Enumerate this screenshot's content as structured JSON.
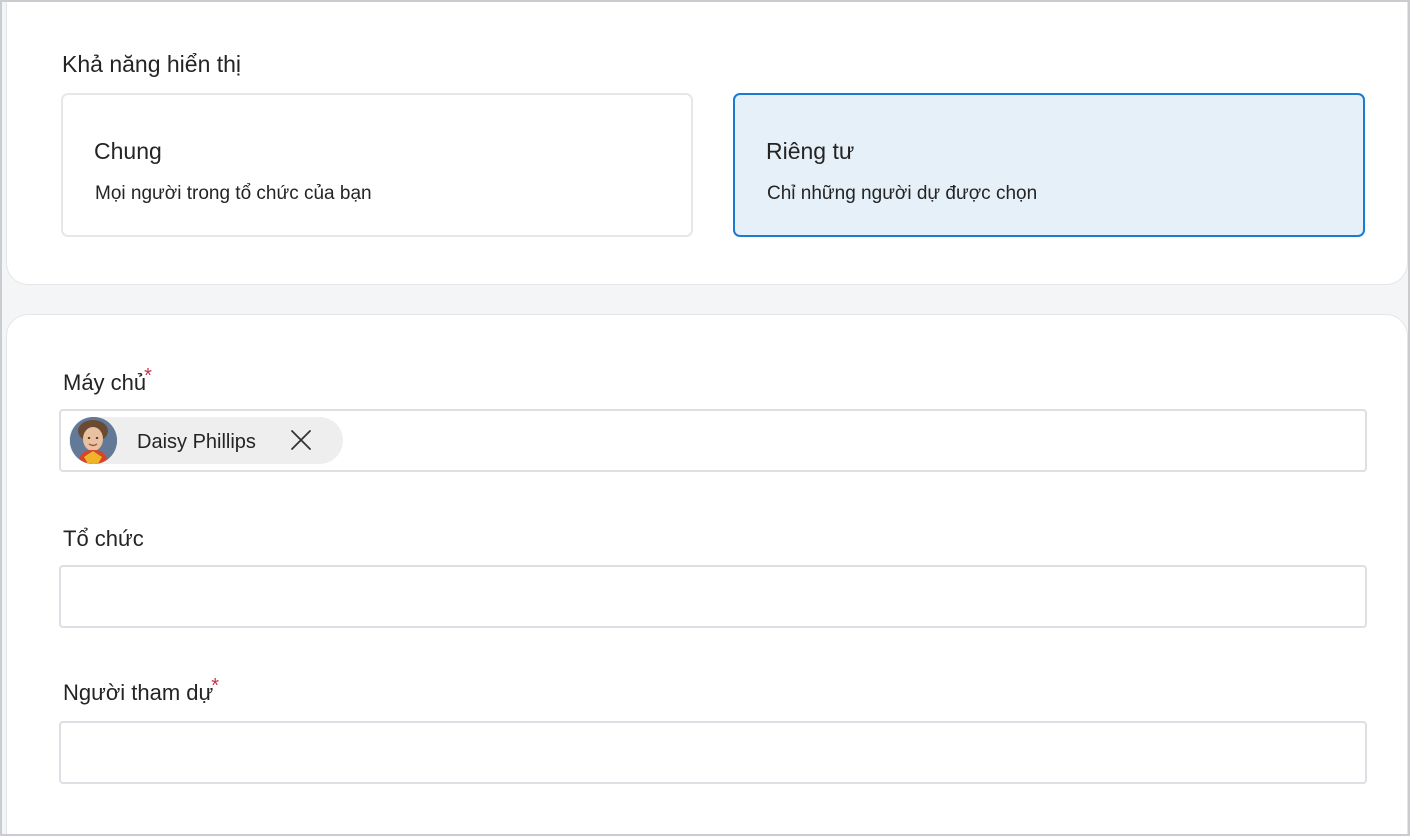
{
  "visibility": {
    "title": "Khả năng hiển thị",
    "options": [
      {
        "title": "Chung",
        "description": "Mọi người trong tổ chức của bạn",
        "selected": false
      },
      {
        "title": "Riêng tư",
        "description": "Chỉ những người dự được chọn",
        "selected": true
      }
    ]
  },
  "fields": {
    "host": {
      "label": "Máy chủ",
      "required_mark": "*",
      "chips": [
        {
          "name": "Daisy Phillips",
          "avatar_icon": "person-avatar-icon",
          "remove_icon": "close-icon"
        }
      ]
    },
    "organization": {
      "label": "Tổ chức",
      "value": ""
    },
    "attendees": {
      "label": "Người tham dự",
      "required_mark": "*",
      "value": ""
    }
  },
  "colors": {
    "accent": "#1a7bd1",
    "selected_bg": "#e6f0f8",
    "required": "#c4314b",
    "chip_bg": "#eeeeee"
  }
}
